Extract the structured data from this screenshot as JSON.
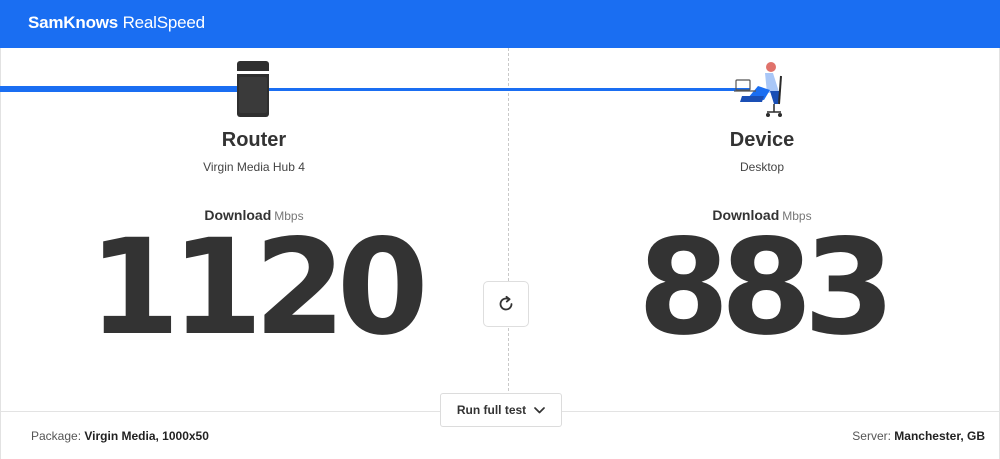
{
  "app": {
    "brand_bold": "SamKnows",
    "brand_light": "RealSpeed"
  },
  "router": {
    "title": "Router",
    "model": "Virgin Media Hub 4",
    "download_label": "Download",
    "unit": "Mbps",
    "value": "1120"
  },
  "device": {
    "title": "Device",
    "type": "Desktop",
    "download_label": "Download",
    "unit": "Mbps",
    "value": "883"
  },
  "actions": {
    "run_full_test": "Run full test"
  },
  "footer": {
    "package_label": "Package:",
    "package_value": "Virgin Media, 1000x50",
    "server_label": "Server:",
    "server_value": "Manchester, GB"
  },
  "colors": {
    "accent": "#1a6ef2",
    "text": "#333333",
    "border": "#e2e2e2"
  },
  "icons": {
    "router": "router-icon",
    "device": "person-at-desk-icon",
    "refresh": "refresh-icon",
    "chevron": "chevron-down-icon"
  }
}
